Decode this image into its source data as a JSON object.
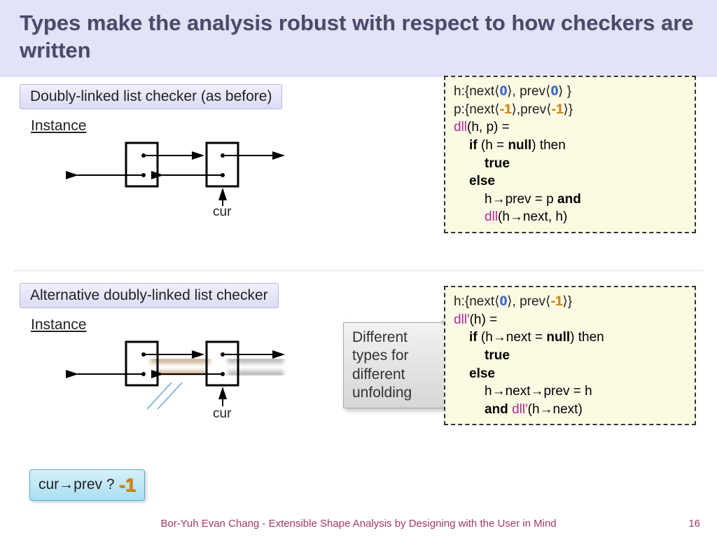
{
  "title": "Types make the analysis robust with respect to how checkers are written",
  "section1": "Doubly-linked list checker (as before)",
  "section2": "Alternative doubly-linked list checker",
  "instance": "Instance",
  "cur": "cur",
  "callout": {
    "l1": "Different",
    "l2": "types for",
    "l3": "different",
    "l4": "unfolding"
  },
  "bubble": {
    "q": "cur→prev ?",
    "val": "-1"
  },
  "code1": {
    "h": "h:{next⟨",
    "zero": "0",
    "h2": "⟩, prev⟨",
    "h3": "⟩ }",
    "p": "p:{next⟨",
    "neg1": "-1",
    "p2": "⟩,prev⟨",
    "p3": "⟩}",
    "dll": "dll",
    "sig": "(h, p) =",
    "if": "if",
    "cond": " (h = ",
    "null": "null",
    "then": ") then",
    "true": "true",
    "else": "else",
    "body1": "h→prev = p  ",
    "and": "and",
    "body2": "(h→next, h)"
  },
  "code2": {
    "h": "h:{next⟨",
    "zero": "0",
    "h2": "⟩, prev⟨",
    "neg1": "-1",
    "h3": "⟩}",
    "dll": "dll′",
    "sig": "(h) =",
    "if": "if",
    "cond": " (h→next = ",
    "null": "null",
    "then": ") then",
    "true": "true",
    "else": "else",
    "body1": "h→next→prev = h",
    "and": "and ",
    "body2": "(h→next)"
  },
  "footer": "Bor-Yuh Evan Chang - Extensible Shape Analysis by Designing with the User in Mind",
  "page": "16"
}
